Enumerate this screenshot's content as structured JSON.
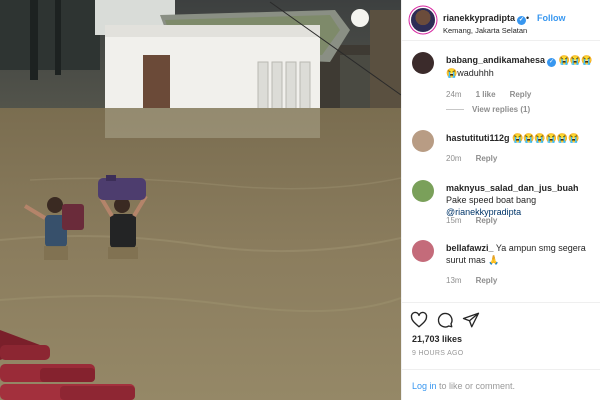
{
  "header": {
    "username": "rianekkypradipta",
    "verified_mark": "✓",
    "separator": "•",
    "follow_label": "Follow",
    "location": "Kemang, Jakarta Selatan"
  },
  "comments": [
    {
      "username": "babang_andikamahesa",
      "verified_mark": "✓",
      "text": " 😭😭😭 😭waduhhh",
      "time": "24m",
      "likes": "1 like",
      "reply": "Reply",
      "view_replies": "View replies (1)",
      "avatar_color": "#3b2b2b"
    },
    {
      "username": "hastutituti112g",
      "text": " 😭😭😭😭😭😭",
      "time": "20m",
      "reply": "Reply",
      "avatar_color": "#b89c84"
    },
    {
      "username": "maknyus_salad_dan_jus_buah",
      "text": " Pake speed boat bang ",
      "mention": "@rianekkypradipta",
      "time": "15m",
      "reply": "Reply",
      "avatar_color": "#7aa05a"
    },
    {
      "username": "bellafawzi_",
      "text": " Ya ampun smg segera surut mas 🙏",
      "time": "13m",
      "reply": "Reply",
      "avatar_color": "#c46b7a"
    }
  ],
  "actions": {
    "icons": [
      "heart-icon",
      "comment-icon",
      "share-icon"
    ],
    "likes": "21,703 likes",
    "time_ago": "9 HOURS AGO",
    "login_link": "Log in",
    "login_suffix": " to like or comment."
  },
  "colors": {
    "link_blue": "#3897f0",
    "text_dark": "#262626",
    "text_muted": "#8e8e8e",
    "flood_water": "#8b7d5e"
  }
}
